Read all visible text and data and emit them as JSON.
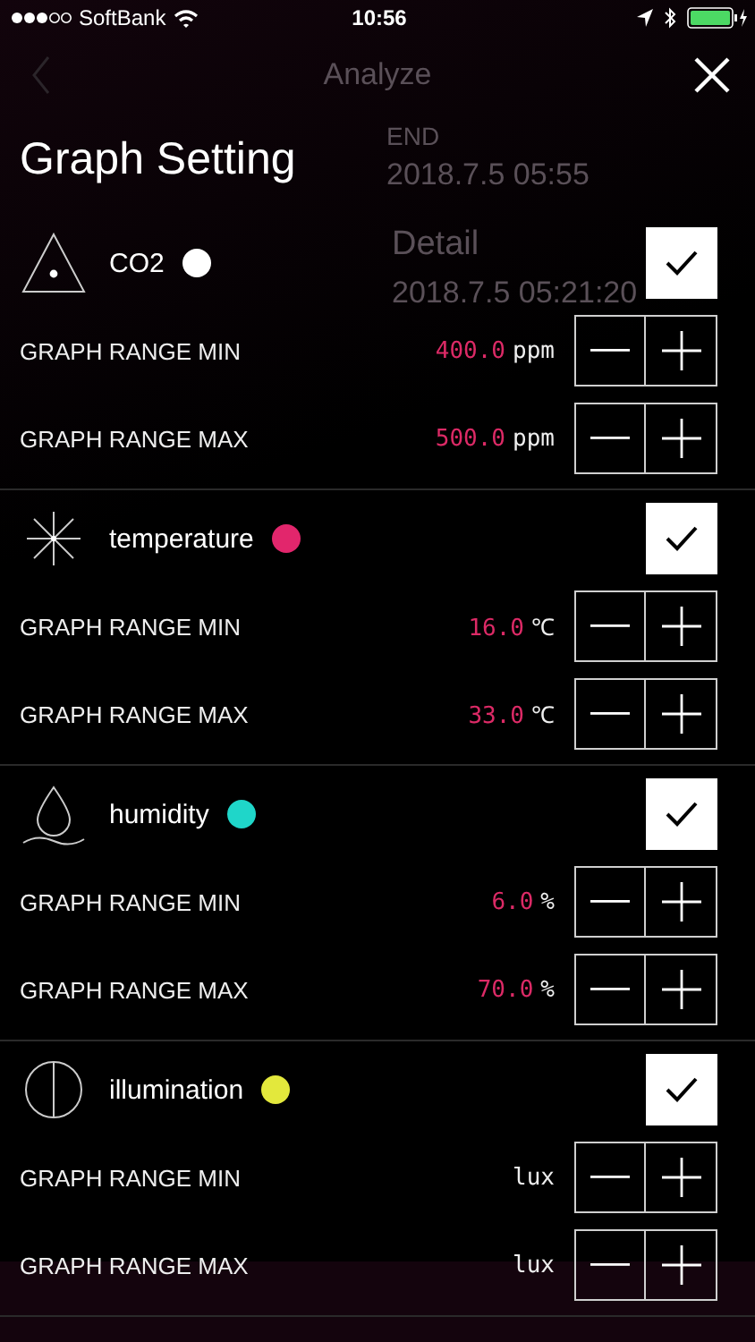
{
  "status_bar": {
    "carrier": "SoftBank",
    "time": "10:56"
  },
  "background": {
    "title": "Analyze",
    "end_label": "END",
    "end_value": "2018.7.5 05:55",
    "detail_title": "Detail",
    "detail_time": "2018.7.5 05:21:20"
  },
  "sheet": {
    "title": "Graph Setting"
  },
  "sensors": [
    {
      "name": "CO2",
      "kind": "triangle",
      "color": "#ffffff",
      "checked": true,
      "rows": [
        {
          "label": "GRAPH RANGE MIN",
          "value": "400.0",
          "unit": "ppm"
        },
        {
          "label": "GRAPH RANGE MAX",
          "value": "500.0",
          "unit": "ppm"
        }
      ]
    },
    {
      "name": "temperature",
      "kind": "star",
      "color": "#e2266c",
      "checked": true,
      "rows": [
        {
          "label": "GRAPH RANGE MIN",
          "value": "16.0",
          "unit": "℃"
        },
        {
          "label": "GRAPH RANGE MAX",
          "value": "33.0",
          "unit": "℃"
        }
      ]
    },
    {
      "name": "humidity",
      "kind": "drop",
      "color": "#1fd6c9",
      "checked": true,
      "rows": [
        {
          "label": "GRAPH RANGE MIN",
          "value": "6.0",
          "unit": "%"
        },
        {
          "label": "GRAPH RANGE MAX",
          "value": "70.0",
          "unit": "%"
        }
      ]
    },
    {
      "name": "illumination",
      "kind": "circle",
      "color": "#e3e83c",
      "checked": true,
      "rows": [
        {
          "label": "GRAPH RANGE MIN",
          "unit": "lux"
        },
        {
          "label": "GRAPH RANGE MAX",
          "unit": "lux"
        }
      ]
    }
  ]
}
